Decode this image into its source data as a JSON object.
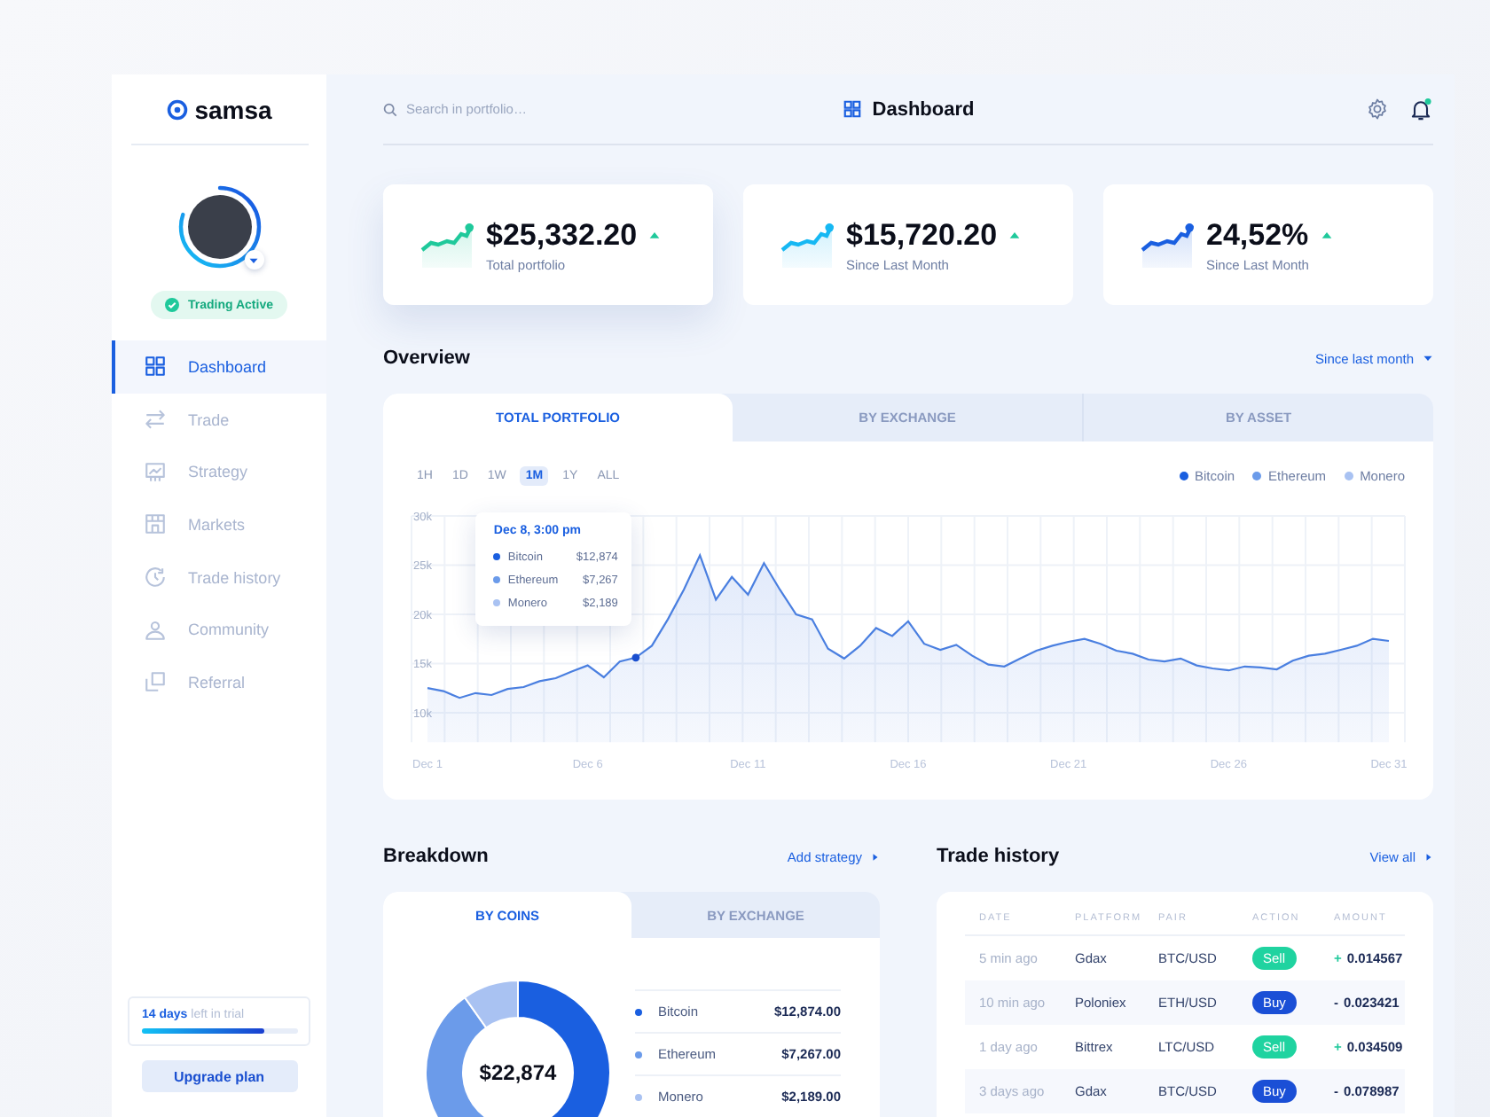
{
  "sidebar": {
    "logo": "samsa",
    "avatar": {
      "level": 0.8
    },
    "status_badge": "Trading Active",
    "nav": [
      {
        "label": "Dashboard",
        "selected": true
      },
      {
        "label": "Trade",
        "selected": false
      },
      {
        "label": "Strategy",
        "selected": false
      },
      {
        "label": "Markets",
        "selected": false
      },
      {
        "label": "Trade history",
        "selected": false
      },
      {
        "label": "Community",
        "selected": false
      },
      {
        "label": "Referral",
        "selected": false
      }
    ],
    "trial": {
      "text": "**14 days** left in trial",
      "level": 0.78
    },
    "upgrade_button": "Upgrade plan"
  },
  "header": {
    "search": {
      "placeholder": "Search in portfolio…"
    },
    "title": "Dashboard",
    "notification": true
  },
  "stats": [
    {
      "value": "$25,332.20",
      "label": "Total portfolio",
      "color": "#1fc99b",
      "selected": true
    },
    {
      "value": "$15,720.20",
      "label": "Since Last Month",
      "color": "#16b8f3",
      "selected": false
    },
    {
      "value": "24,52%",
      "label": "Since Last Month",
      "color": "#1a5fe0",
      "selected": false
    }
  ],
  "overview": {
    "title": "Overview",
    "period": "Since last month",
    "tabs": [
      {
        "label": "TOTAL PORTFOLIO",
        "selected": true
      },
      {
        "label": "BY EXCHANGE",
        "selected": false
      },
      {
        "label": "BY ASSET",
        "selected": false
      }
    ],
    "ranges": [
      {
        "label": "1H",
        "selected": false
      },
      {
        "label": "1D",
        "selected": false
      },
      {
        "label": "1W",
        "selected": false
      },
      {
        "label": "1M",
        "selected": true
      },
      {
        "label": "1Y",
        "selected": false
      },
      {
        "label": "ALL",
        "selected": false
      }
    ],
    "legend": [
      {
        "name": "Bitcoin",
        "color": "#1a5fe0"
      },
      {
        "name": "Ethereum",
        "color": "#6b9bea"
      },
      {
        "name": "Monero",
        "color": "#a9c2f2"
      }
    ],
    "chart_data": {
      "type": "area",
      "categories": [
        "Dec 1",
        null,
        null,
        null,
        null,
        null,
        null,
        null,
        null,
        null,
        "Dec 6",
        null,
        null,
        null,
        null,
        null,
        null,
        null,
        null,
        null,
        "Dec 11",
        null,
        null,
        null,
        null,
        null,
        null,
        null,
        null,
        null,
        "Dec 16",
        null,
        null,
        null,
        null,
        null,
        null,
        null,
        null,
        null,
        "Dec 21",
        null,
        null,
        null,
        null,
        null,
        null,
        null,
        null,
        null,
        "Dec 26",
        null,
        null,
        null,
        null,
        null,
        null,
        null,
        null,
        null,
        "Dec 31"
      ],
      "values": [
        12500,
        12200,
        11500,
        12000,
        11800,
        12400,
        12600,
        13200,
        13500,
        14200,
        14800,
        13600,
        15200,
        15600,
        16800,
        19500,
        22500,
        26000,
        21500,
        23800,
        22000,
        25200,
        22500,
        20000,
        19500,
        16500,
        15500,
        16800,
        18600,
        17800,
        19300,
        17000,
        16400,
        16900,
        15800,
        14900,
        14700,
        15500,
        16300,
        16800,
        17200,
        17500,
        17000,
        16300,
        16000,
        15400,
        15200,
        15500,
        14800,
        14500,
        14300,
        14700,
        14600,
        14400,
        15300,
        15800,
        16000,
        16400,
        16800,
        17500,
        17300
      ],
      "ylim": [
        7000,
        30000
      ],
      "yticks": [
        {
          "value": 30000,
          "label": "30k"
        },
        {
          "value": 25000,
          "label": "25k"
        },
        {
          "value": 20000,
          "label": "20k"
        },
        {
          "value": 15000,
          "label": "15k"
        },
        {
          "value": 10000,
          "label": "10k"
        }
      ],
      "grid": true
    },
    "tooltip": {
      "title": "Dec 8, 3:00 pm",
      "rows": [
        {
          "name": "Bitcoin",
          "value": "$12,874",
          "color": "#1a5fe0"
        },
        {
          "name": "Ethereum",
          "value": "$7,267",
          "color": "#6b9bea"
        },
        {
          "name": "Monero",
          "value": "$2,189",
          "color": "#a9c2f2"
        }
      ]
    }
  },
  "breakdown": {
    "title": "Breakdown",
    "link": "Add strategy",
    "tabs": [
      {
        "label": "BY COINS",
        "selected": true
      },
      {
        "label": "BY EXCHANGE",
        "selected": false
      }
    ],
    "total": "$22,874",
    "chart_data": {
      "type": "donut",
      "categories": [
        "Bitcoin",
        "Ethereum",
        "Monero"
      ],
      "values": [
        57.6,
        32.6,
        9.8
      ]
    },
    "items": [
      {
        "value": "$12,874.00",
        "color": "#1a5fe0"
      },
      {
        "value": "$7,267.00",
        "color": "#6b9bea"
      },
      {
        "value": "$2,189.00",
        "color": "#a9c2f2"
      }
    ]
  },
  "trade_history": {
    "title": "Trade history",
    "link": "View all",
    "columns": [
      "DATE",
      "PLATFORM",
      "PAIR",
      "ACTION",
      "AMOUNT"
    ],
    "rows": [
      {
        "date": "5 min ago",
        "platform": "Gdax",
        "pair": "BTC/USD",
        "action": {
          "label": "Sell",
          "kind": "sell"
        },
        "sign": "+",
        "amount": "0.014567"
      },
      {
        "date": "10 min ago",
        "platform": "Poloniex",
        "pair": "ETH/USD",
        "action": {
          "label": "Buy",
          "kind": "buy"
        },
        "sign": "-",
        "amount": "0.023421"
      },
      {
        "date": "1 day ago",
        "platform": "Bittrex",
        "pair": "LTC/USD",
        "action": {
          "label": "Sell",
          "kind": "sell"
        },
        "sign": "+",
        "amount": "0.034509"
      },
      {
        "date": "3 days ago",
        "platform": "Gdax",
        "pair": "BTC/USD",
        "action": {
          "label": "Buy",
          "kind": "buy"
        },
        "sign": "-",
        "amount": "0.078987"
      }
    ]
  }
}
